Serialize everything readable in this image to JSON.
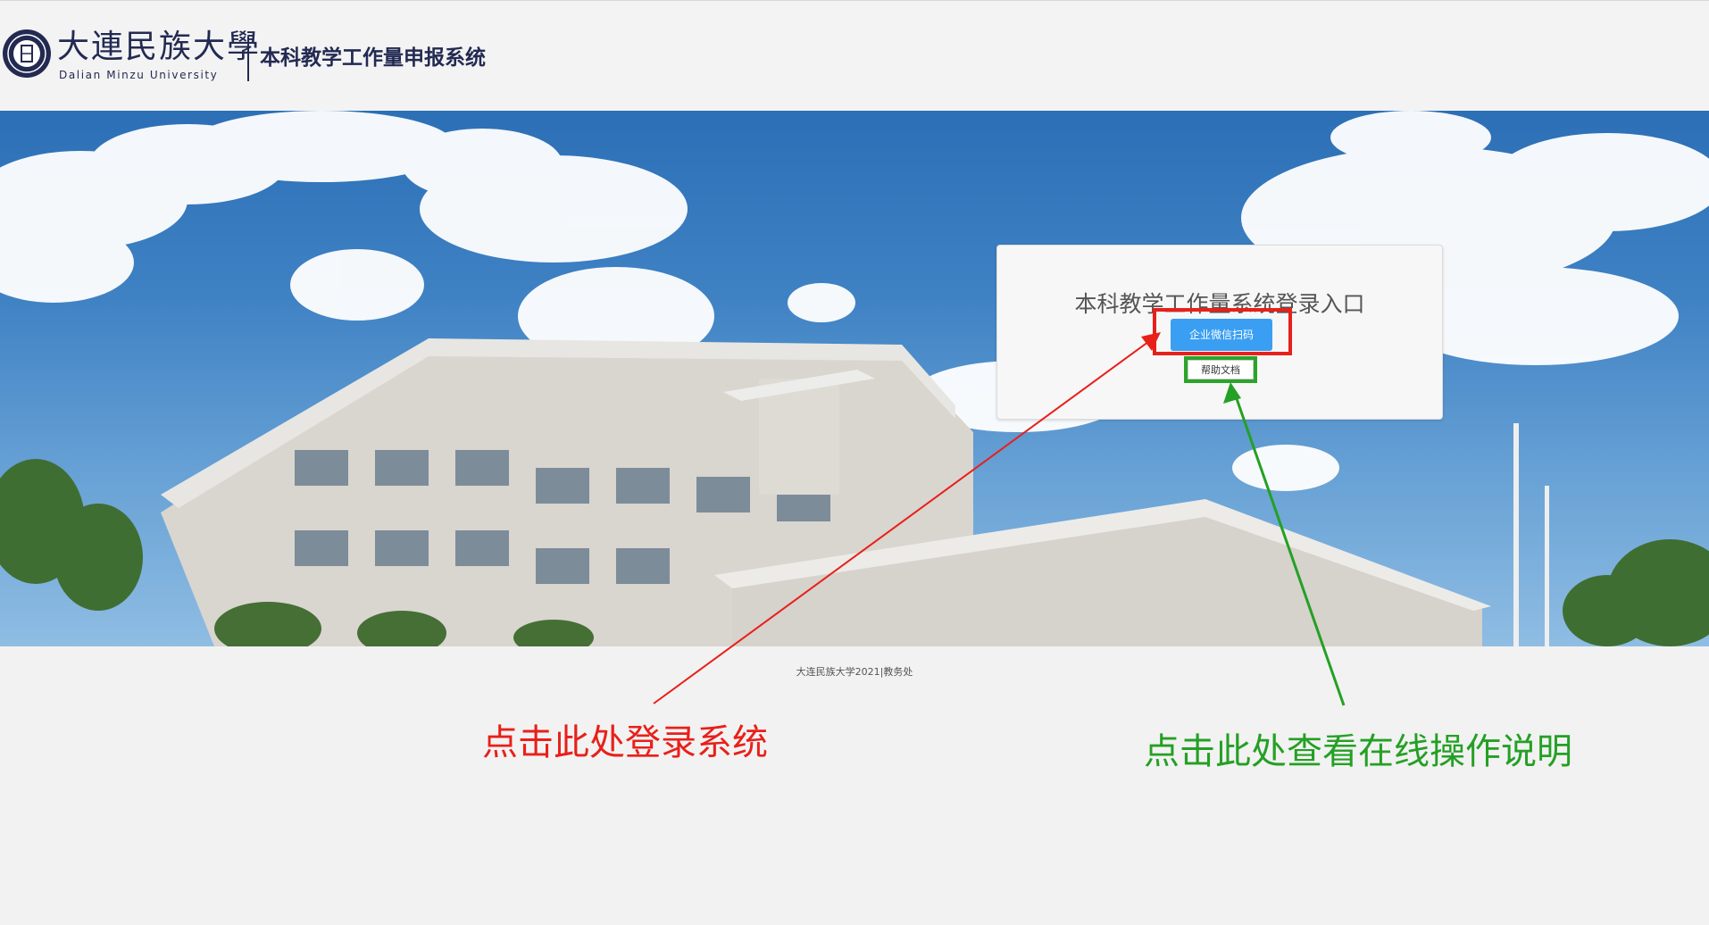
{
  "header": {
    "logo_cn": "大連民族大學",
    "logo_en": "Dalian Minzu University",
    "system_title": "本科教学工作量申报系统"
  },
  "login": {
    "title": "本科教学工作量系统登录入口",
    "wechat_button": "企业微信扫码",
    "help_button": "帮助文档"
  },
  "footer": {
    "copyright": "大连民族大学2021|教务处"
  },
  "annotations": {
    "login_hint": "点击此处登录系统",
    "help_hint": "点击此处查看在线操作说明"
  },
  "colors": {
    "brand": "#232a52",
    "button": "#3a9ff2",
    "annotation_red": "#e8201a",
    "annotation_green": "#24a024"
  }
}
